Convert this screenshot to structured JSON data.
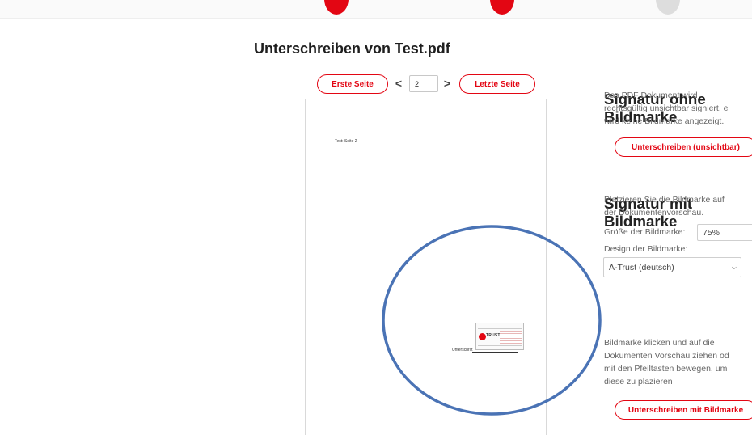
{
  "page": {
    "title": "Unterschreiben von Test.pdf"
  },
  "pager": {
    "first_label": "Erste Seite",
    "prev_icon": "chevron-left-icon",
    "prev_glyph": "<",
    "current_page": "2",
    "next_icon": "chevron-right-icon",
    "next_glyph": ">",
    "last_label": "Letzte Seite"
  },
  "preview": {
    "page_text": "Test: Seite 2",
    "signature_label": "Unterschrift",
    "stamp_logo_text": "TRUST"
  },
  "invisible_signature": {
    "heading": "Signatur ohne Bildmarke",
    "description_lines": [
      "Das PDF Dokument wird",
      "rechtsgültig unsichtbar signiert, e",
      "wird keine Bildmarke angezeigt."
    ],
    "button_label": "Unterschreiben (unsichtbar)"
  },
  "visible_signature": {
    "heading": "Signatur mit Bildmarke",
    "description_lines": [
      "Platzieren Sie die Bildmarke auf",
      "der Dokumentenvorschau."
    ],
    "size_label": "Größe der Bildmarke:",
    "size_value": "75%",
    "design_label": "Design der Bildmarke:",
    "design_value": "A-Trust (deutsch)",
    "drag_hint_lines": [
      "Bildmarke klicken und auf die",
      "Dokumenten Vorschau ziehen od",
      "mit den Pfeiltasten bewegen, um",
      "diese zu plazieren"
    ],
    "button_label": "Unterschreiben mit Bildmarke"
  },
  "colors": {
    "accent": "#e30613",
    "annotation": "#4a73b5"
  }
}
